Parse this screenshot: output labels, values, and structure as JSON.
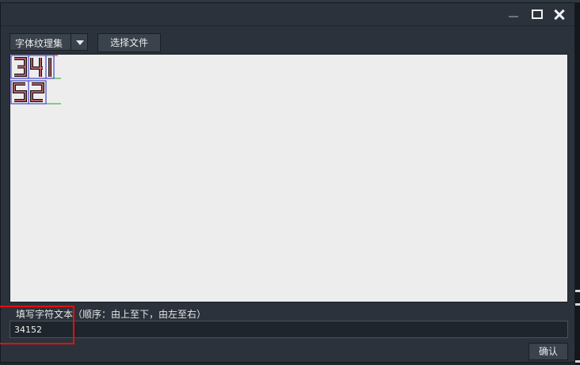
{
  "dialog": {
    "window_buttons": [
      "minimize",
      "maximize",
      "close"
    ]
  },
  "toolbar": {
    "font_type_value": "字体纹理集",
    "choose_file_label": "选择文件"
  },
  "canvas": {
    "rows": [
      [
        "3",
        "4",
        "1"
      ],
      [
        "5",
        "2"
      ]
    ]
  },
  "input": {
    "hint": "填写字符文本（顺序：由上至下，由左至右）",
    "value": "34152"
  },
  "footer": {
    "confirm_label": "确认"
  },
  "colors": {
    "window_bg": "#2b323b",
    "canvas_bg": "#ededed",
    "highlight": "#e01010",
    "glyph_box": "#2323c8",
    "baseline": "#1aa81a"
  }
}
